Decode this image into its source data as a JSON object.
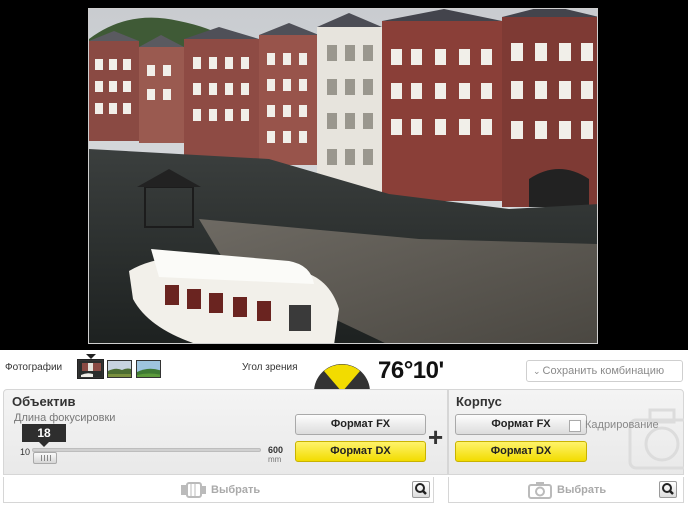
{
  "photos": {
    "label": "Фотографии",
    "thumbnails": [
      "thumb-canal",
      "thumb-field",
      "thumb-landscape"
    ],
    "selected_index": 0
  },
  "view_angle": {
    "label": "Угол зрения",
    "value": "76°10'",
    "indicator_colors": {
      "fill": "#f2dc00",
      "base": "#333333"
    }
  },
  "save_combination": {
    "label": "Сохранить комбинацию",
    "icon": "chevron-down-icon"
  },
  "lens_panel": {
    "title": "Объектив",
    "focal_length_label": "Длина фокусировки",
    "focal_length_value": "18",
    "slider": {
      "min_label": "10",
      "max_label": "600",
      "unit": "mm",
      "value": 18,
      "min": 10,
      "max": 600
    },
    "format_fx_label": "Формат FX",
    "format_dx_label": "Формат DX",
    "selected_format": "DX"
  },
  "plus_sign": "+",
  "body_panel": {
    "title": "Корпус",
    "format_fx_label": "Формат FX",
    "format_dx_label": "Формат DX",
    "selected_format": "DX",
    "crop_label": "Кадрирование",
    "crop_checked": false
  },
  "lens_select": {
    "label": "Выбрать",
    "icon": "lens-icon",
    "search_icon": "search-icon"
  },
  "body_select": {
    "label": "Выбрать",
    "icon": "camera-icon",
    "search_icon": "search-icon"
  },
  "colors": {
    "accent_yellow": "#f2dc00",
    "panel_bg": "#efefef"
  }
}
